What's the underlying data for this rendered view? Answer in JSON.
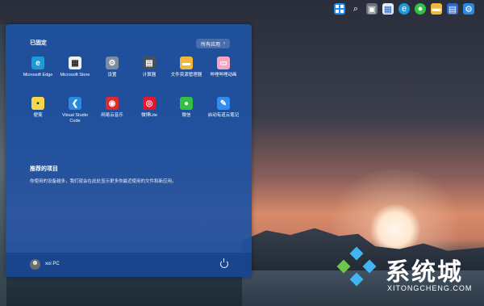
{
  "taskbar": {
    "icons": [
      "windows-start-icon",
      "search-icon",
      "task-view-icon",
      "widgets-icon",
      "edge-icon",
      "wechat-icon",
      "file-explorer-icon",
      "store-icon",
      "settings-icon"
    ]
  },
  "start_menu": {
    "pinned_title": "已固定",
    "all_apps_label": "所有应用",
    "all_apps_chevron": "›",
    "apps": [
      {
        "label": "Microsoft Edge",
        "icon": "edge-icon",
        "color": "#1e9bd7",
        "glyph": "e"
      },
      {
        "label": "Microsoft Store",
        "icon": "store-icon",
        "color": "#f0f0f0",
        "glyph": "▦"
      },
      {
        "label": "设置",
        "icon": "settings-icon",
        "color": "#7c8ba0",
        "glyph": "⚙"
      },
      {
        "label": "计算器",
        "icon": "calculator-icon",
        "color": "#4a4f57",
        "glyph": "▤"
      },
      {
        "label": "文件资源管理器",
        "icon": "folder-icon",
        "color": "#f2b73a",
        "glyph": "▬"
      },
      {
        "label": "哔哩哔哩动画",
        "icon": "bilibili-icon",
        "color": "#f6a6c1",
        "glyph": "▭"
      },
      {
        "label": "便笺",
        "icon": "sticky-notes-icon",
        "color": "#f6d84a",
        "glyph": "▪"
      },
      {
        "label": "Visual Studio Code",
        "icon": "vscode-icon",
        "color": "#2a8ae0",
        "glyph": "❮"
      },
      {
        "label": "网易云音乐",
        "icon": "netease-music-icon",
        "color": "#e0282e",
        "glyph": "◉"
      },
      {
        "label": "微博Lite",
        "icon": "weibo-icon",
        "color": "#e6162d",
        "glyph": "◎"
      },
      {
        "label": "微信",
        "icon": "wechat-icon",
        "color": "#33c143",
        "glyph": "●"
      },
      {
        "label": "启动有道云笔记",
        "icon": "youdao-note-icon",
        "color": "#2f8cf0",
        "glyph": "✎"
      }
    ],
    "recommended_title": "推荐的项目",
    "recommended_text": "你使用的设备越多，我们就会在此处显示更多你最近使用的文件和新应用。",
    "user_name": "xoi PC"
  },
  "logo": {
    "title": "系统城",
    "subtitle": "XITONGCHENG.COM"
  }
}
